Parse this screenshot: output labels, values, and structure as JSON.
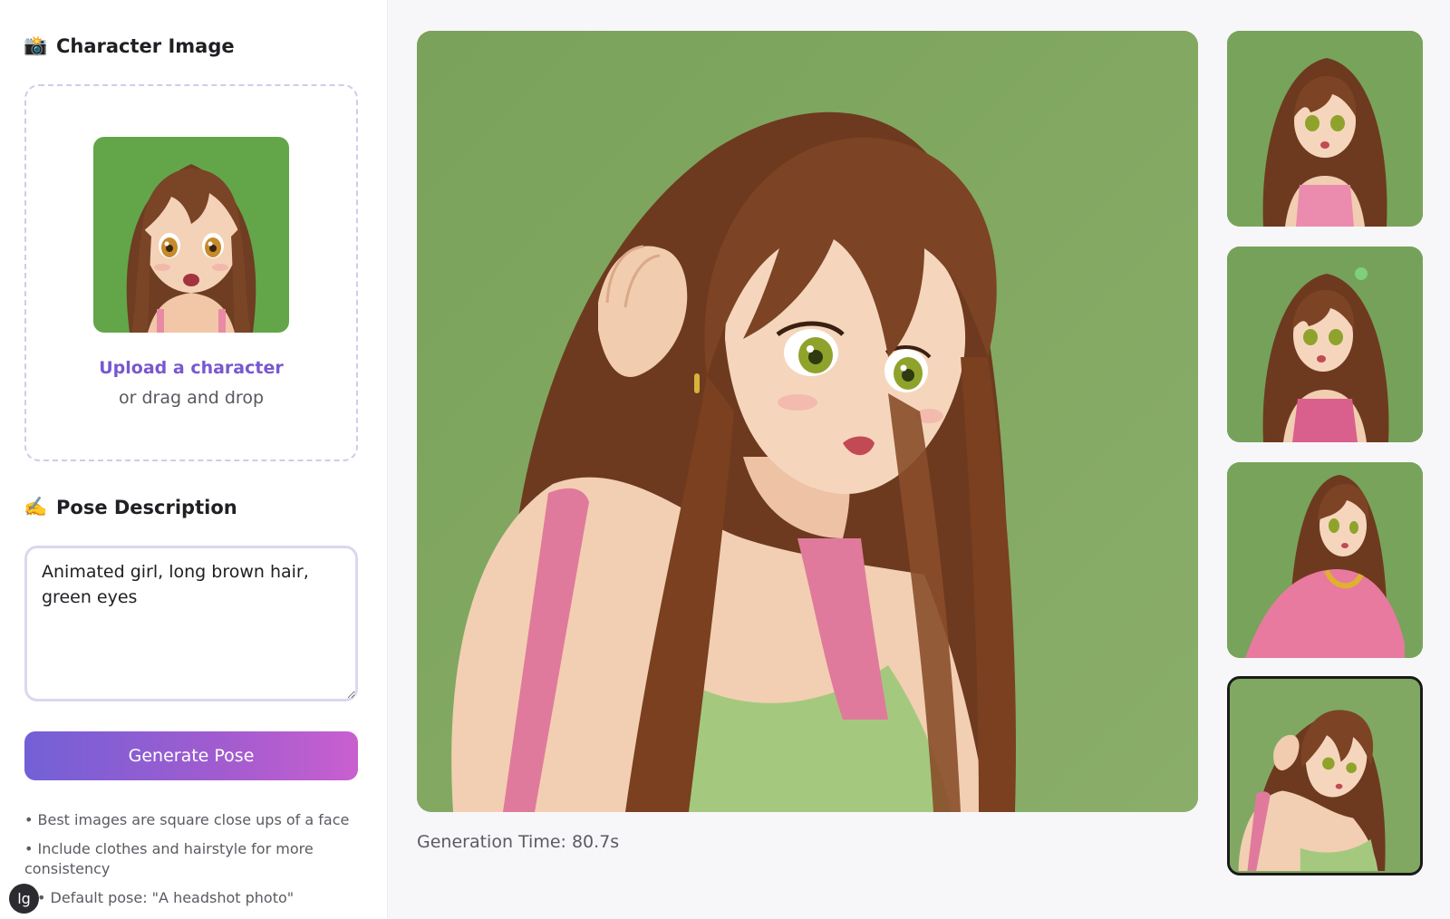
{
  "sidebar": {
    "character_section": {
      "icon": "camera-flash-icon",
      "emoji": "📸",
      "title": "Character Image"
    },
    "upload": {
      "link_text": "Upload a character",
      "sub_text": "or drag and drop"
    },
    "pose_section": {
      "icon": "writing-hand-icon",
      "emoji": "✍️",
      "title": "Pose Description"
    },
    "pose_input": {
      "value": "Animated girl, long brown hair, green eyes"
    },
    "generate_button": {
      "label": "Generate Pose"
    },
    "tips": [
      "• Best images are square close ups of a face",
      "• Include clothes and hairstyle for more consistency",
      "• Default pose: \"A headshot photo\""
    ],
    "badge": {
      "label": "lg"
    }
  },
  "main": {
    "generation_time": "Generation Time: 80.7s"
  },
  "gallery": {
    "count": 4,
    "selected_index": 3
  },
  "colors": {
    "accent": "#7858cf",
    "button_gradient_start": "#7360d6",
    "button_gradient_end": "#c95fcf",
    "image_background": "#83a862",
    "hair": "#7a4426",
    "eyes": "#8fa32c"
  }
}
